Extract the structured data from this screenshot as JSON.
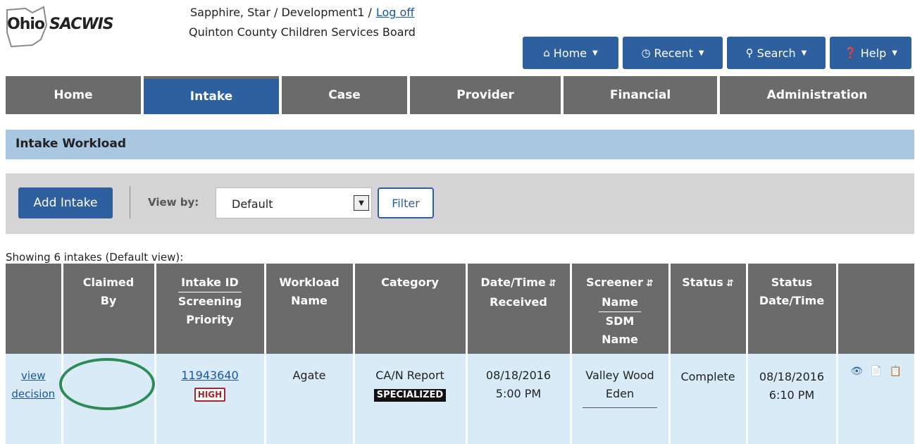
{
  "header": {
    "logo_ohio": "Ohio",
    "logo_sacwis": "SACWIS",
    "user": "Sapphire, Star / Development1 /",
    "logoff": "Log off",
    "agency": "Quinton County Children Services Board"
  },
  "top_buttons": [
    {
      "label": "Home",
      "icon": "home-icon"
    },
    {
      "label": "Recent",
      "icon": "clock-icon"
    },
    {
      "label": "Search",
      "icon": "search-icon"
    },
    {
      "label": "Help",
      "icon": "question-icon"
    }
  ],
  "nav": [
    {
      "label": "Home"
    },
    {
      "label": "Intake",
      "active": true
    },
    {
      "label": "Case"
    },
    {
      "label": "Provider"
    },
    {
      "label": "Financial"
    },
    {
      "label": "Administration"
    }
  ],
  "section_title": "Intake Workload",
  "toolbar": {
    "add_label": "Add Intake",
    "viewby_label": "View by:",
    "select_value": "Default",
    "filter_label": "Filter"
  },
  "showing": "Showing 6 intakes (Default view):",
  "table": {
    "headers": {
      "claimed": [
        "Claimed",
        "By"
      ],
      "intake_id": "Intake ID",
      "screening_priority": [
        "Screening",
        "Priority"
      ],
      "workload": [
        "Workload",
        "Name"
      ],
      "category": "Category",
      "received": [
        "Date/Time",
        "Received"
      ],
      "screener": [
        "Screener",
        "Name"
      ],
      "sdm": [
        "SDM",
        "Name"
      ],
      "status": "Status",
      "status_dt": [
        "Status",
        "Date/Time"
      ]
    },
    "row": {
      "view_link_1": "view",
      "view_link_2": "decision",
      "claimed_by": "",
      "intake_id": "11943640",
      "priority": "HIGH",
      "workload": "Agate",
      "category": "CA/N Report",
      "category_badge": "SPECIALIZED",
      "received_date": "08/18/2016",
      "received_time": "5:00 PM",
      "screener_1": "Valley Wood",
      "screener_2": "Eden",
      "status": "Complete",
      "status_date": "08/18/2016",
      "status_time": "6:10 PM"
    }
  },
  "colors": {
    "primary": "#2e5f9e",
    "nav_gray": "#6b6b6b",
    "section_blue": "#a8c7e1",
    "row_bg": "#d8ebf6",
    "annotation": "#2e8b57"
  }
}
